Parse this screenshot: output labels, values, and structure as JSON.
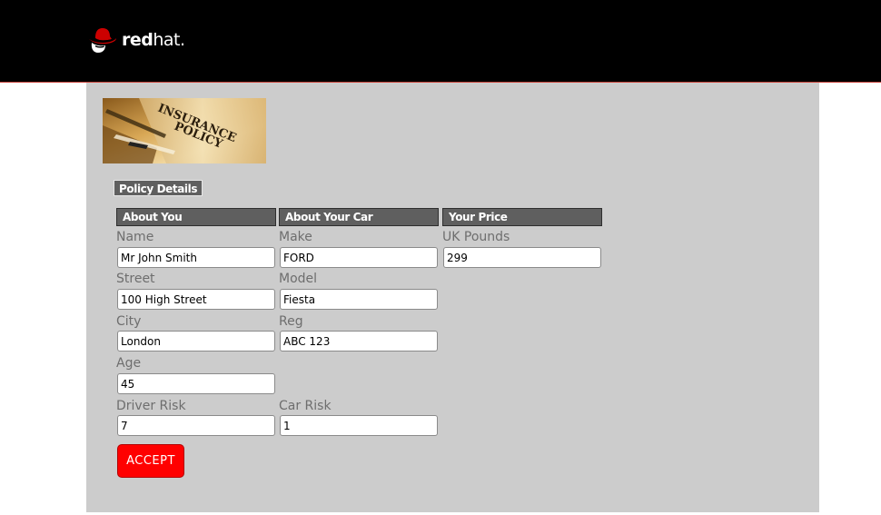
{
  "header": {
    "logo": {
      "text_bold": "red",
      "text_regular": "hat.",
      "brand_color": "#cc0000",
      "icon": "shadowman-icon"
    },
    "accent_line_color": "#c9463d"
  },
  "banner": {
    "icon": "insurance-policy-image",
    "image_text": [
      "INSURANCE",
      "POLICY"
    ]
  },
  "section_tab": "Policy Details",
  "columns": {
    "about_you": {
      "title": "About You",
      "fields": {
        "name": {
          "label": "Name",
          "value": "Mr John Smith"
        },
        "street": {
          "label": "Street",
          "value": "100 High Street"
        },
        "city": {
          "label": "City",
          "value": "London"
        },
        "age": {
          "label": "Age",
          "value": "45"
        },
        "driver_risk": {
          "label": "Driver Risk",
          "value": "7"
        }
      }
    },
    "about_car": {
      "title": "About Your Car",
      "fields": {
        "make": {
          "label": "Make",
          "value": "FORD"
        },
        "model": {
          "label": "Model",
          "value": "Fiesta"
        },
        "reg": {
          "label": "Reg",
          "value": "ABC 123"
        },
        "car_risk": {
          "label": "Car Risk",
          "value": "1"
        }
      }
    },
    "your_price": {
      "title": "Your Price",
      "fields": {
        "uk_pounds": {
          "label": "UK Pounds",
          "value": "299"
        }
      }
    }
  },
  "actions": {
    "accept_label": "ACCEPT",
    "accept_color": "#ff0000"
  },
  "colors": {
    "panel_bg": "#cccccc",
    "header_bg": "#000000",
    "column_header_bg": "#5f5f5f",
    "label_text": "#6e6e6e"
  }
}
